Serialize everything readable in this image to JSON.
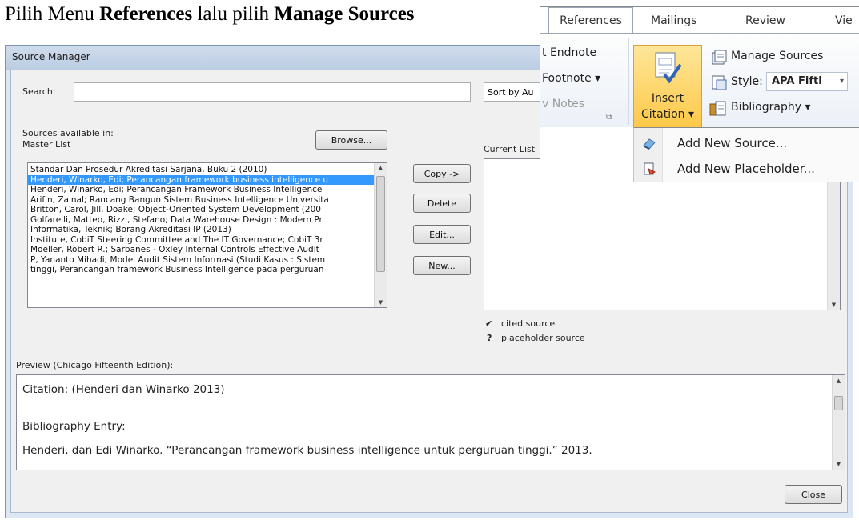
{
  "instruction": {
    "prefix": "Pilih Menu ",
    "menu": "References",
    "middle": " lalu pilih ",
    "command": "Manage Sources"
  },
  "dialog": {
    "title": "Source Manager",
    "search_label": "Search:",
    "search_value": "",
    "sort_label": "Sort by Au",
    "sources_available_label": "Sources available in:",
    "master_list_label": "Master List",
    "browse_button": "Browse...",
    "current_list_label": "Current List",
    "master_list": [
      "Standar Dan Prosedur Akreditasi Sarjana, Buku 2 (2010)",
      "Henderi, Winarko, Edi; Perancangan framework business intelligence u",
      "Henderi, Winarko, Edi; Perancangan Framework Business Intelligence",
      "Arifin, Zainal; Rancang Bangun Sistem Business Intelligence Universita",
      "Britton, Carol, Jill, Doake; Object-Oriented System Development (200",
      "Golfarelli, Matteo, Rizzi, Stefano; Data Warehouse Design : Modern Pr",
      "Informatika, Teknik; Borang Akreditasi IP (2013)",
      "Institute, CobiT Steering Committee and The IT Governance; CobiT 3r",
      "Moeller, Robert R.; Sarbanes - Oxley Internal Controls Effective Audit",
      "P, Yananto Mihadi; Model Audit Sistem Informasi (Studi Kasus : Sistem",
      "tinggi, Perancangan framework Business Intelligence pada perguruan"
    ],
    "selected_index": 1,
    "buttons": {
      "copy": "Copy ->",
      "delete": "Delete",
      "edit": "Edit...",
      "new": "New..."
    },
    "legend": {
      "cited_mark": "✔",
      "cited": "cited source",
      "placeholder_mark": "?",
      "placeholder": "placeholder source"
    },
    "preview_label": "Preview (Chicago Fifteenth Edition):",
    "preview": {
      "citation": "Citation:  (Henderi dan Winarko 2013)",
      "bibliography_heading": "Bibliography Entry:",
      "bibliography_entry": "Henderi, dan Edi Winarko. “Perancangan framework business intelligence untuk perguruan tinggi.” 2013."
    },
    "close_button": "Close"
  },
  "ribbon": {
    "tabs": [
      "References",
      "Mailings",
      "Review",
      "Vie"
    ],
    "active_tab": "References",
    "footnotes_group": {
      "insert_endnote": "t Endnote",
      "next_footnote": "Footnote ▾",
      "show_notes": "v Notes"
    },
    "insert_citation": {
      "line1": "Insert",
      "line2": "Citation ▾"
    },
    "manage_sources": "Manage Sources",
    "style_label": "Style:",
    "style_value": "APA Fiftl",
    "bibliography": "Bibliography ▾",
    "citation_menu": [
      "Add New Source...",
      "Add New Placeholder..."
    ]
  },
  "colors": {
    "selection": "#3399ff",
    "citation_button": "#ffc847",
    "dialog_frame": "#dde7f3"
  }
}
